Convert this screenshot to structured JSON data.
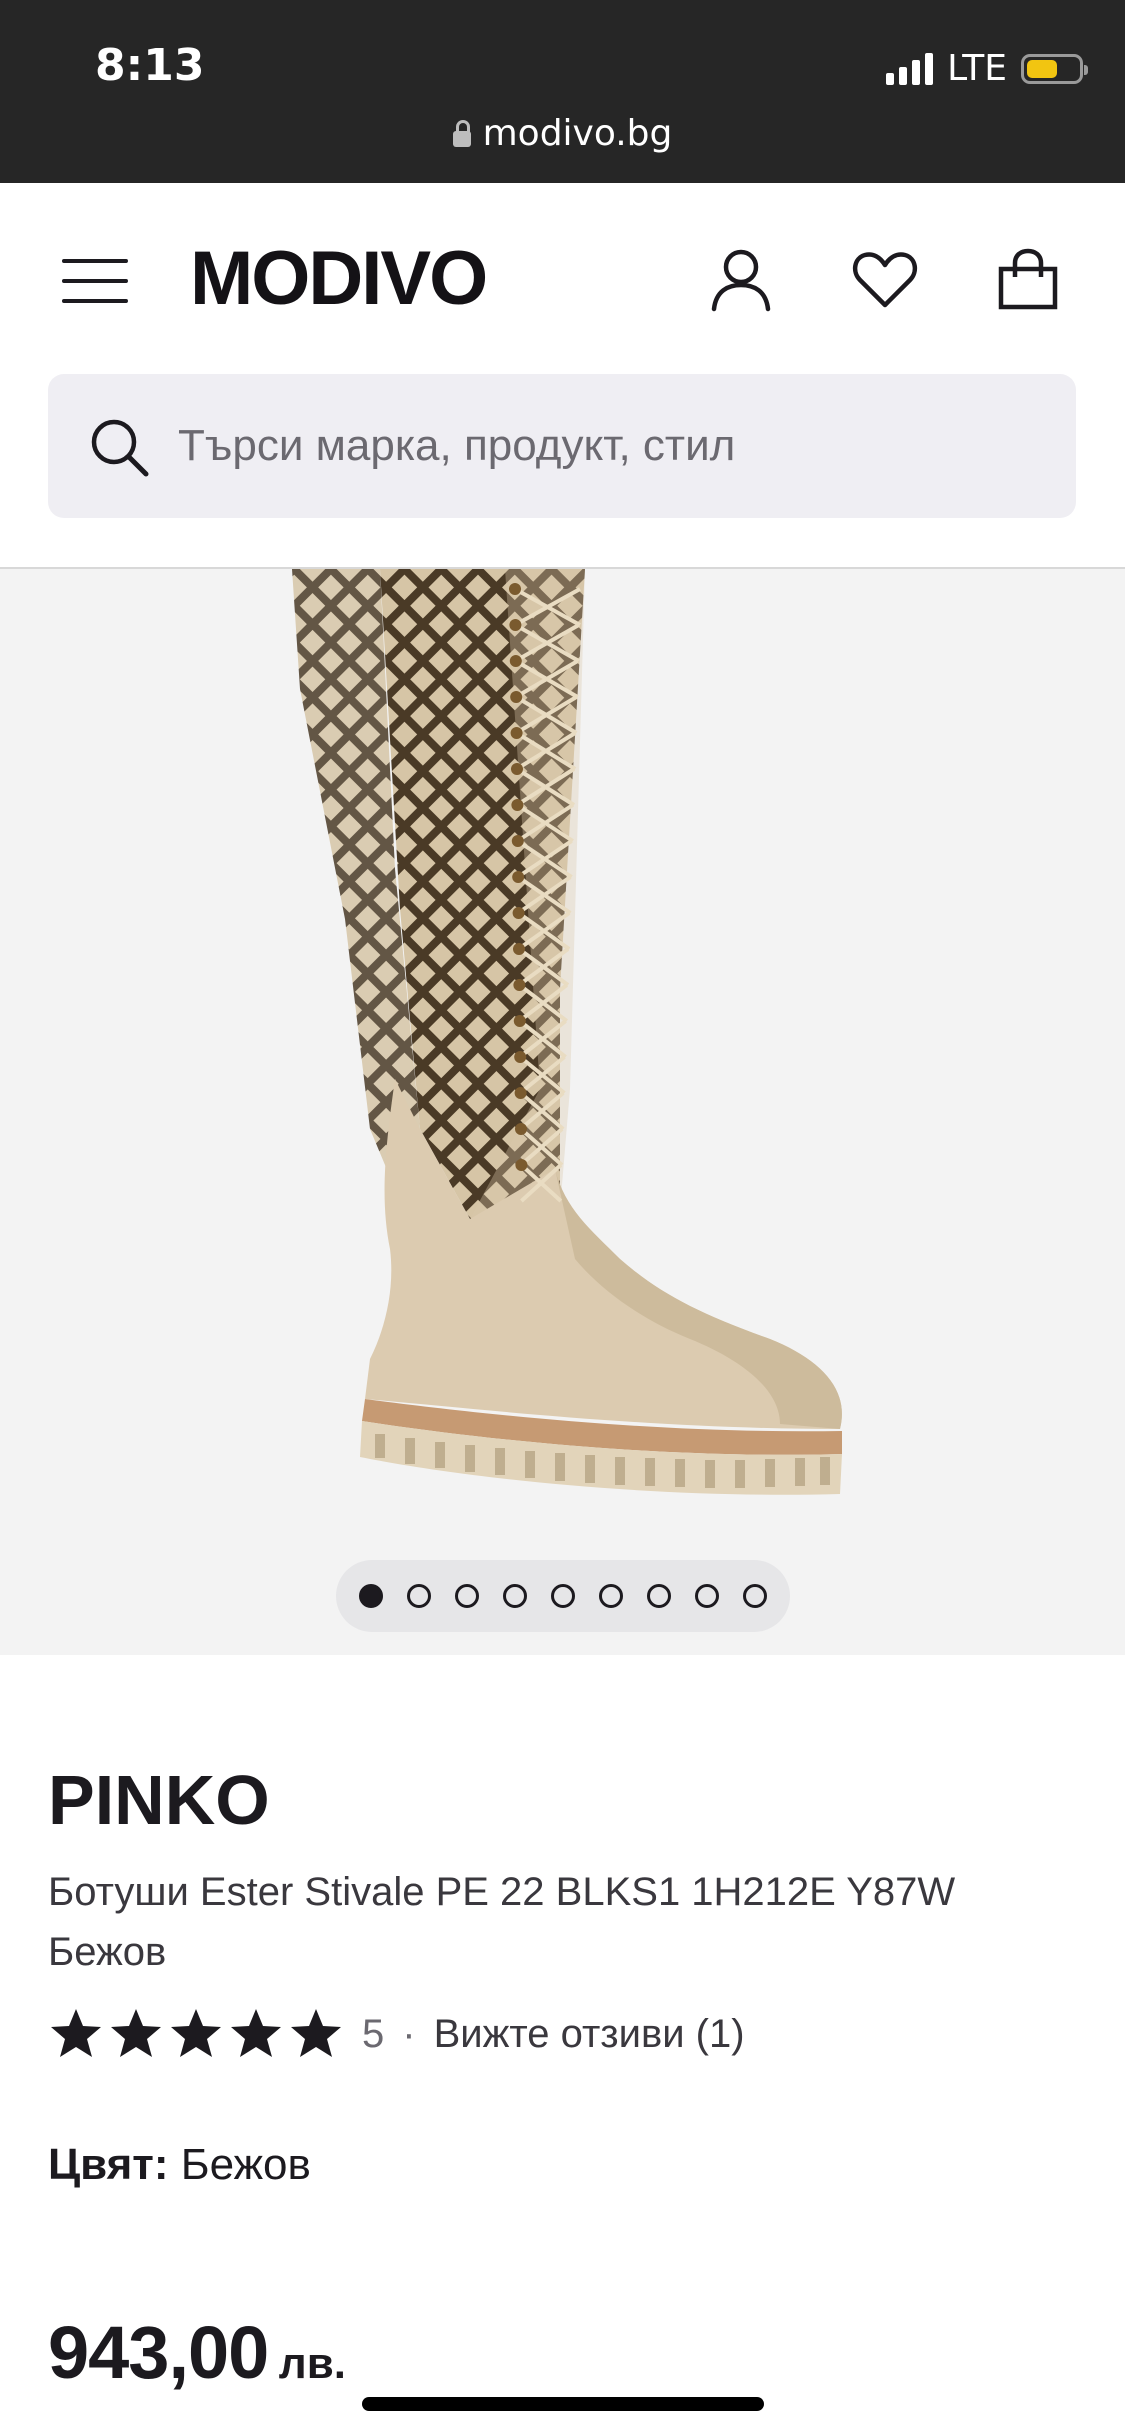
{
  "status_bar": {
    "time": "8:13",
    "network": "LTE",
    "battery_level": 0.6
  },
  "url_bar": {
    "domain": "modivo.bg"
  },
  "header": {
    "logo": "MODIVO",
    "icons": [
      "menu-icon",
      "user-icon",
      "heart-icon",
      "bag-icon"
    ]
  },
  "search": {
    "placeholder": "Търси марка, продукт, стил",
    "value": ""
  },
  "gallery": {
    "image_count": 9,
    "active_index": 0
  },
  "product": {
    "brand": "PINKO",
    "name": "Ботуши Ester Stivale PE 22 BLKS1 1H212E Y87W Бежов",
    "rating": "5",
    "rating_stars": 5,
    "rating_separator": "·",
    "reviews_link": "Вижте отзиви (1)",
    "color_label": "Цвят:",
    "color_value": "Бежов",
    "price": "943,00",
    "currency": "лв."
  },
  "colors": {
    "status_bg": "#262626",
    "search_bg": "#efeef3",
    "gallery_bg": "#f3f3f3",
    "boot": "#d9c9ad",
    "text": "#1c1a1f",
    "battery": "#f2c511"
  }
}
